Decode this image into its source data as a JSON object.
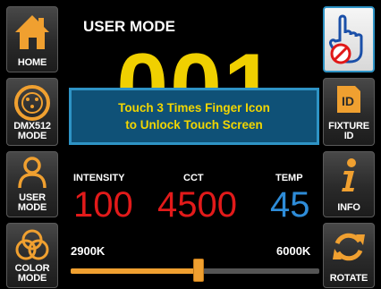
{
  "colors": {
    "accent_yellow": "#f0d000",
    "intensity_red": "#e21a1a",
    "cct_red": "#e21a1a",
    "temp_blue": "#2e8cd8",
    "dialog_bg": "#0f5177",
    "dialog_border": "#2e93c5",
    "slider_orange": "#f0a030"
  },
  "left_sidebar": [
    {
      "label": "HOME",
      "icon": "home-icon"
    },
    {
      "label": "DMX512\nMODE",
      "icon": "dmx-connector-icon"
    },
    {
      "label": "USER\nMODE",
      "icon": "user-icon"
    },
    {
      "label": "COLOR\nMODE",
      "icon": "color-circles-icon"
    }
  ],
  "right_sidebar": [
    {
      "label": "",
      "icon": "touch-lock-finger-icon"
    },
    {
      "label": "FIXTURE\nID",
      "icon": "id-card-icon"
    },
    {
      "label": "INFO",
      "icon": "info-icon"
    },
    {
      "label": "ROTATE",
      "icon": "rotate-icon"
    }
  ],
  "header": {
    "title": "USER MODE"
  },
  "mode_number": "001",
  "lock_message": {
    "line1": "Touch 3 Times Finger Icon",
    "line2": "to Unlock Touch Screen"
  },
  "params": {
    "intensity": {
      "label": "INTENSITY",
      "value": "100"
    },
    "cct": {
      "label": "CCT",
      "value": "4500"
    },
    "temp": {
      "label": "TEMP",
      "value": "45"
    }
  },
  "cct_slider": {
    "min_label": "2900K",
    "max_label": "6000K",
    "min": 2900,
    "max": 6000,
    "value": 4500
  }
}
